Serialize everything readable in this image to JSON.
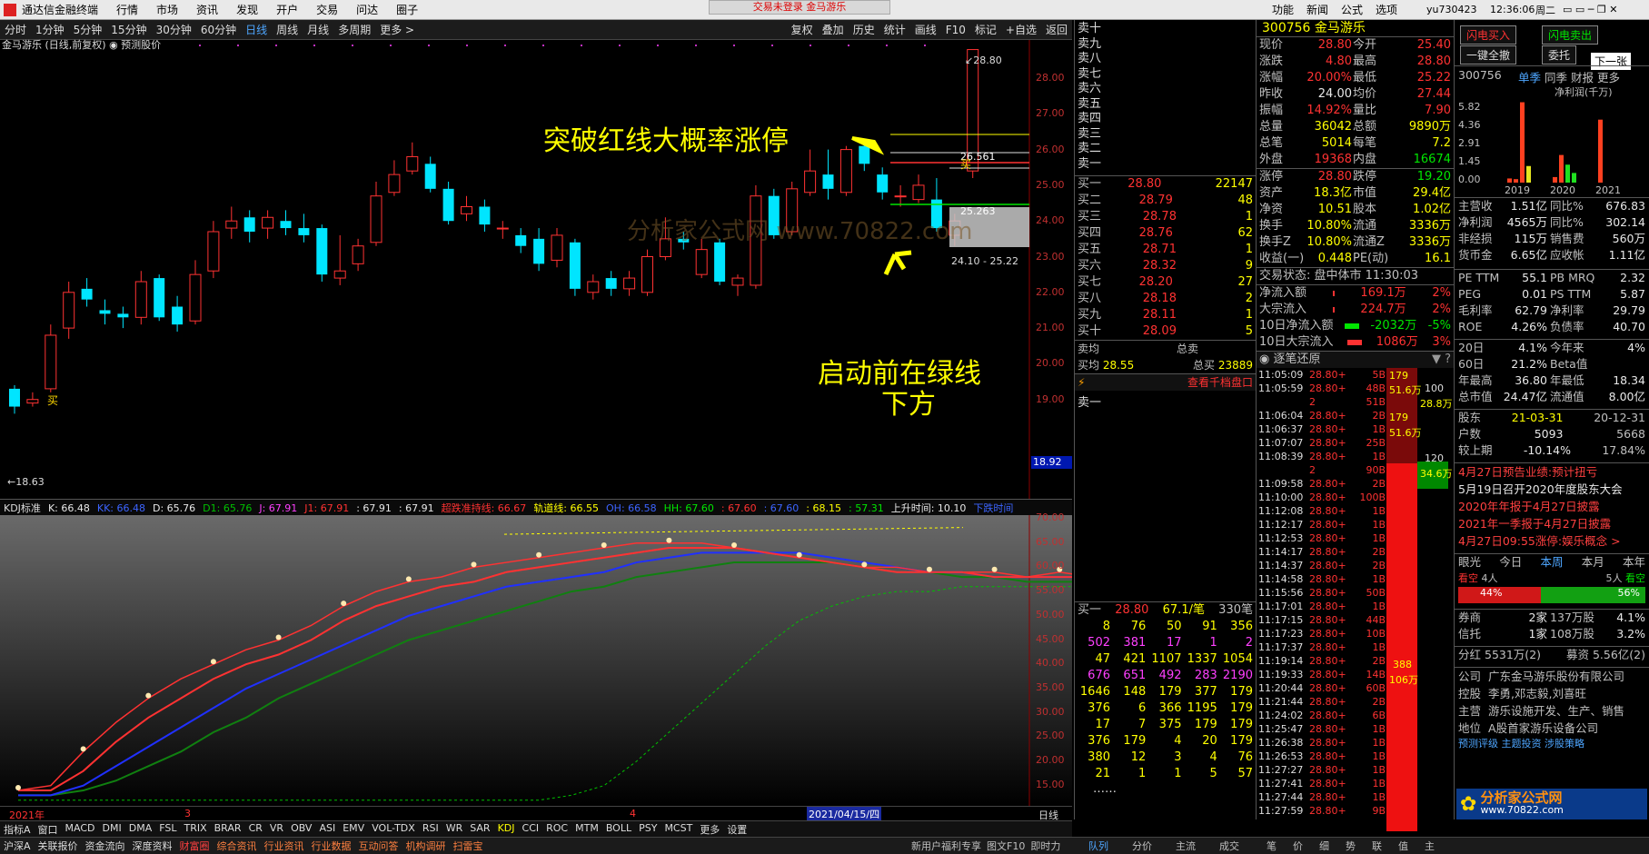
{
  "menubar": {
    "app_title": "通达信金融终端",
    "items": [
      "行情",
      "市场",
      "资讯",
      "发现",
      "开户",
      "交易",
      "问达",
      "圈子"
    ],
    "notice": "交易未登录  金马游乐",
    "right_items": [
      "功能",
      "新闻",
      "公式",
      "选项"
    ],
    "user": "yu730423",
    "time": "12:36:06",
    "day": "周二"
  },
  "toolbar": {
    "periods": [
      "分时",
      "1分钟",
      "5分钟",
      "15分钟",
      "30分钟",
      "60分钟",
      "日线",
      "周线",
      "月线",
      "多周期",
      "更多 >"
    ],
    "active_period": "日线",
    "right": [
      "复权",
      "叠加",
      "历史",
      "统计",
      "画线",
      "F10",
      "标记",
      "+自选",
      "返回"
    ]
  },
  "chart_header": {
    "title": "金马游乐 (日线,前复权)",
    "predict": "预测股价"
  },
  "kline": {
    "price_axis": [
      "28.00",
      "27.00",
      "26.00",
      "25.00",
      "24.00",
      "23.00",
      "22.00",
      "21.00",
      "20.00",
      "19.00"
    ],
    "current_price_tag": "18.92",
    "low_label": "18.63",
    "high_label": "28.80",
    "line_label_1": "26.561",
    "line_label_2": "25.263",
    "range_label": "24.10 - 25.22",
    "buy_marker": "买",
    "buy_marker2": "买",
    "annotation_1": "突破红线大概率涨停",
    "annotation_2_line1": "启动前在绿线",
    "annotation_2_line2": "下方",
    "watermark": "分析家公式网 www.70822.com"
  },
  "kdj_bar": {
    "name": "KDJ标准",
    "items": [
      {
        "t": "K: 66.48",
        "c": "#e8e8e8"
      },
      {
        "t": "KK: 66.48",
        "c": "#3c64ff"
      },
      {
        "t": "D: 65.76",
        "c": "#e8e8e8"
      },
      {
        "t": "D1: 65.76",
        "c": "#00c000"
      },
      {
        "t": "J: 67.91",
        "c": "#ff40ff"
      },
      {
        "t": "J1: 67.91",
        "c": "#ff3232"
      },
      {
        "t": ": 67.91",
        "c": "#e8e8e8"
      },
      {
        "t": ": 67.91",
        "c": "#e8e8e8"
      },
      {
        "t": "超跌准持线: 66.67",
        "c": "#ff3232"
      },
      {
        "t": "轨道线: 66.55",
        "c": "#ffff00"
      },
      {
        "t": "OH: 66.58",
        "c": "#3c64ff"
      },
      {
        "t": "HH: 67.60",
        "c": "#00e600"
      },
      {
        "t": ": 67.60",
        "c": "#ff3232"
      },
      {
        "t": ": 67.60",
        "c": "#3c64ff"
      },
      {
        "t": ": 68.15",
        "c": "#ffff00"
      },
      {
        "t": ": 57.31",
        "c": "#00e600"
      },
      {
        "t": "上升时间: 10.10",
        "c": "#e8e8e8"
      },
      {
        "t": "下跌时间",
        "c": "#3c64ff"
      }
    ]
  },
  "kdj": {
    "axis": [
      "70.00",
      "65.00",
      "60.00",
      "55.00",
      "50.00",
      "45.00",
      "40.00",
      "35.00",
      "30.00",
      "25.00",
      "20.00",
      "15.00"
    ],
    "marker_buy": "买",
    "marker_sell": "卖"
  },
  "date_axis": {
    "left": "2021年",
    "mid1": "3",
    "mid2": "4",
    "cursor": "2021/04/15/四",
    "right": "日线"
  },
  "index_tabs": [
    "指标A",
    "窗口",
    "MACD",
    "DMI",
    "DMA",
    "FSL",
    "TRIX",
    "BRAR",
    "CR",
    "VR",
    "OBV",
    "ASI",
    "EMV",
    "VOL-TDX",
    "RSI",
    "WR",
    "SAR",
    "KDJ",
    "CCI",
    "ROC",
    "MTM",
    "BOLL",
    "PSY",
    "MCST",
    "更多",
    "设置"
  ],
  "status_tabs": [
    "沪深A",
    "关联报价",
    "资金流向",
    "深度资料",
    "财富圈",
    "综合资讯",
    "行业资讯",
    "行业数据",
    "互动问答",
    "机构调研",
    "扫雷宝"
  ],
  "status_right": [
    "新用户福利专享",
    "图文F10",
    "即时力"
  ],
  "orders": {
    "sells": [
      "卖十",
      "卖九",
      "卖八",
      "卖七",
      "卖六",
      "卖五",
      "卖四",
      "卖三",
      "卖二",
      "卖一"
    ],
    "buys": [
      [
        "买一",
        "28.80",
        "22147"
      ],
      [
        "买二",
        "28.79",
        "48"
      ],
      [
        "买三",
        "28.78",
        "1"
      ],
      [
        "买四",
        "28.76",
        "62"
      ],
      [
        "买五",
        "28.71",
        "1"
      ],
      [
        "买六",
        "28.32",
        "9"
      ],
      [
        "买七",
        "28.20",
        "27"
      ],
      [
        "买八",
        "28.18",
        "2"
      ],
      [
        "买九",
        "28.11",
        "1"
      ],
      [
        "买十",
        "28.09",
        "5"
      ]
    ],
    "sell_avg": "卖均",
    "sell_total": "总卖",
    "buy_avg": "买均",
    "buy_avg_val": "28.55",
    "buy_total": "总买",
    "buy_total_val": "23889",
    "view_link": "查看千档盘口",
    "sell1_label": "卖一",
    "buy1_row": [
      "买一",
      "28.80",
      "67.1/笔",
      "330笔"
    ],
    "queue": [
      [
        "8",
        "76",
        "50",
        "91",
        "356"
      ],
      [
        "502",
        "381",
        "17",
        "1",
        "2"
      ],
      [
        "47",
        "421",
        "1107",
        "1337",
        "1054"
      ],
      [
        "676",
        "651",
        "492",
        "283",
        "2190"
      ],
      [
        "1646",
        "148",
        "179",
        "377",
        "179"
      ],
      [
        "376",
        "6",
        "366",
        "1195",
        "179"
      ],
      [
        "17",
        "7",
        "375",
        "179",
        "179"
      ],
      [
        "376",
        "179",
        "4",
        "20",
        "179"
      ],
      [
        "380",
        "12",
        "3",
        "4",
        "76"
      ],
      [
        "21",
        "1",
        "1",
        "5",
        "57"
      ]
    ],
    "queue_more": "……",
    "bottom_tabs": [
      "队列",
      "分价",
      "主流",
      "成交"
    ]
  },
  "quote": {
    "code": "300756",
    "name": "金马游乐",
    "rows": [
      [
        "现价",
        "28.80",
        "今开",
        "25.40"
      ],
      [
        "涨跌",
        "4.80",
        "最高",
        "28.80"
      ],
      [
        "涨幅",
        "20.00%",
        "最低",
        "25.22"
      ],
      [
        "昨收",
        "24.00",
        "均价",
        "27.44"
      ],
      [
        "振幅",
        "14.92%",
        "量比",
        "7.90"
      ],
      [
        "总量",
        "36042",
        "总额",
        "9890万"
      ],
      [
        "总笔",
        "5014",
        "每笔",
        "7.2"
      ],
      [
        "外盘",
        "19368",
        "内盘",
        "16674"
      ]
    ],
    "rows2": [
      [
        "涨停",
        "28.80",
        "跌停",
        "19.20"
      ],
      [
        "资产",
        "18.3亿",
        "市值",
        "29.4亿"
      ],
      [
        "净资",
        "10.51",
        "股本",
        "1.02亿"
      ],
      [
        "换手",
        "10.80%",
        "流通",
        "3336万"
      ],
      [
        "换手Z",
        "10.80%",
        "流通Z",
        "3336万"
      ],
      [
        "收益(一)",
        "0.448",
        "PE(动)",
        "16.1"
      ]
    ],
    "trade_state": "交易状态: 盘中体市 11:30:03",
    "flows": [
      [
        "净流入额",
        "169.1万",
        "2%"
      ],
      [
        "大宗流入",
        "224.7万",
        "2%"
      ],
      [
        "10日净流入额",
        "-2032万",
        "-5%"
      ],
      [
        "10日大宗流入",
        "1086万",
        "3%"
      ]
    ],
    "tick_title": "逐笔还原",
    "ticks": [
      [
        "11:05:09",
        "28.80+",
        "5B"
      ],
      [
        "11:05:59",
        "28.80+",
        "48B"
      ],
      [
        "",
        "2",
        "51B"
      ],
      [
        "11:06:04",
        "28.80+",
        "2B"
      ],
      [
        "11:06:37",
        "28.80+",
        "1B"
      ],
      [
        "11:07:07",
        "28.80+",
        "25B"
      ],
      [
        "11:08:39",
        "28.80+",
        "1B"
      ],
      [
        "",
        "2",
        "90B"
      ],
      [
        "11:09:58",
        "28.80+",
        "2B"
      ],
      [
        "11:10:00",
        "28.80+",
        "100B"
      ],
      [
        "11:12:08",
        "28.80+",
        "1B"
      ],
      [
        "11:12:17",
        "28.80+",
        "1B"
      ],
      [
        "11:12:53",
        "28.80+",
        "1B"
      ],
      [
        "11:14:17",
        "28.80+",
        "2B"
      ],
      [
        "11:14:37",
        "28.80+",
        "2B"
      ],
      [
        "11:14:58",
        "28.80+",
        "1B"
      ],
      [
        "11:15:56",
        "28.80+",
        "50B"
      ],
      [
        "11:17:01",
        "28.80+",
        "1B"
      ],
      [
        "11:17:15",
        "28.80+",
        "44B"
      ],
      [
        "11:17:23",
        "28.80+",
        "10B"
      ],
      [
        "11:17:37",
        "28.80+",
        "1B"
      ],
      [
        "11:19:14",
        "28.80+",
        "2B"
      ],
      [
        "11:19:33",
        "28.80+",
        "14B"
      ],
      [
        "11:20:44",
        "28.80+",
        "60B"
      ],
      [
        "11:21:44",
        "28.80+",
        "2B"
      ],
      [
        "11:24:02",
        "28.80+",
        "6B"
      ],
      [
        "11:25:47",
        "28.80+",
        "1B"
      ],
      [
        "11:26:38",
        "28.80+",
        "1B"
      ],
      [
        "11:26:53",
        "28.80+",
        "1B"
      ],
      [
        "11:27:27",
        "28.80+",
        "1B"
      ],
      [
        "11:27:41",
        "28.80+",
        "1B"
      ],
      [
        "11:27:44",
        "28.80+",
        "1B"
      ],
      [
        "11:27:59",
        "28.80+",
        "9B"
      ]
    ],
    "tick_tags": [
      "179",
      "51.6万",
      "100",
      "28.8万",
      "179",
      "51.6万",
      "120",
      "34.6万",
      "388",
      "106万"
    ],
    "bottom_tabs": [
      "笔",
      "价",
      "细",
      "势",
      "联",
      "值",
      "主"
    ]
  },
  "right": {
    "btn_flash_buy": "闪电买入",
    "btn_flash_sell": "闪电卖出",
    "btn_cancel_all": "一键全撤",
    "btn_entrust": "委托",
    "next": "下一张",
    "fin_code": "300756",
    "fin_tabs": [
      "单季",
      "同季",
      "财报",
      "更多"
    ],
    "fin_title": "净利润(千万)",
    "fin_axis": [
      "5.82",
      "4.36",
      "2.91",
      "1.45",
      "0.00"
    ],
    "fin_years": [
      "2019",
      "2020",
      "2021"
    ],
    "fin_rows": [
      [
        "主营收",
        "1.51亿",
        "同比%",
        "676.83"
      ],
      [
        "净利润",
        "4565万",
        "同比%",
        "302.14"
      ],
      [
        "非经损",
        "115万",
        "销售费",
        "560万"
      ],
      [
        "货币金",
        "6.65亿",
        "应收帐",
        "1.11亿"
      ]
    ],
    "val_rows": [
      [
        "PE TTM",
        "55.1",
        "PB MRQ",
        "2.32"
      ],
      [
        "PEG",
        "0.01",
        "PS TTM",
        "5.87"
      ],
      [
        "毛利率",
        "62.79",
        "净利率",
        "29.79"
      ],
      [
        "ROE",
        "4.26%",
        "负债率",
        "40.70"
      ]
    ],
    "perf_rows": [
      [
        "20日",
        "4.1%",
        "今年来",
        "4%"
      ],
      [
        "60日",
        "21.2%",
        "Beta值",
        ""
      ],
      [
        "年最高",
        "36.80",
        "年最低",
        "18.34"
      ],
      [
        "总市值",
        "24.47亿",
        "流通值",
        "8.00亿"
      ]
    ],
    "holder": [
      [
        "股东",
        "21-03-31",
        "20-12-31"
      ],
      [
        "户数",
        "5093",
        "5668"
      ],
      [
        "较上期",
        "-10.14%",
        "17.84%"
      ]
    ],
    "news": [
      "4月27日预告业绩:预计扭亏",
      "5月19日召开2020年度股东大会",
      "2020年年报于4月27日披露",
      "2021年一季报于4月27日披露",
      "4月27日09:55涨停:娱乐概念 >"
    ],
    "view_tabs": [
      "眼光",
      "今日",
      "本周",
      "本月",
      "本年"
    ],
    "bear": "看空",
    "bear_n": "4人",
    "bull_n": "5人",
    "bull": "看空",
    "bear_pct": "44%",
    "bull_pct": "56%",
    "broker_rows": [
      [
        "券商",
        "2家",
        "137万股",
        "4.1%"
      ],
      [
        "信托",
        "1家",
        "108万股",
        "3.2%"
      ]
    ],
    "div": [
      "分红",
      "5531万(2)",
      "募资",
      "5.56亿(2)"
    ],
    "company": [
      [
        "公司",
        "广东金马游乐股份有限公司"
      ],
      [
        "控股",
        "李勇,邓志毅,刘喜旺"
      ],
      [
        "主营",
        "游乐设施开发、生产、销售"
      ],
      [
        "地位",
        "A股首家游乐设备公司"
      ]
    ],
    "more": "预测评级  主题投资  涉股策略",
    "logo": "分析家公式网",
    "logo_url": "www.70822.com"
  },
  "colors": {
    "up": "#ff3232",
    "down": "#00e5ff",
    "ma_white": "#e8e8e8",
    "line_red": "#ff3232",
    "line_green": "#00e600",
    "line_yellow": "#ffff00"
  }
}
